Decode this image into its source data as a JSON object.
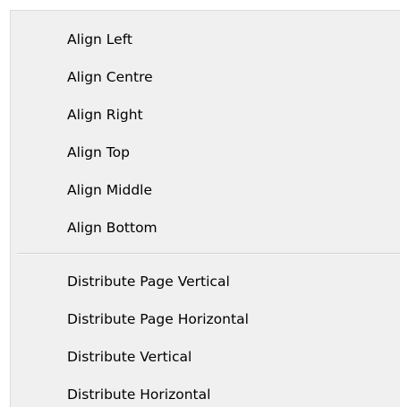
{
  "menu": {
    "align_group": [
      {
        "label": "Align Left"
      },
      {
        "label": "Align Centre"
      },
      {
        "label": "Align Right"
      },
      {
        "label": "Align Top"
      },
      {
        "label": "Align Middle"
      },
      {
        "label": "Align Bottom"
      }
    ],
    "distribute_group": [
      {
        "label": "Distribute Page Vertical"
      },
      {
        "label": "Distribute Page Horizontal"
      },
      {
        "label": "Distribute Vertical"
      },
      {
        "label": "Distribute Horizontal"
      }
    ]
  }
}
